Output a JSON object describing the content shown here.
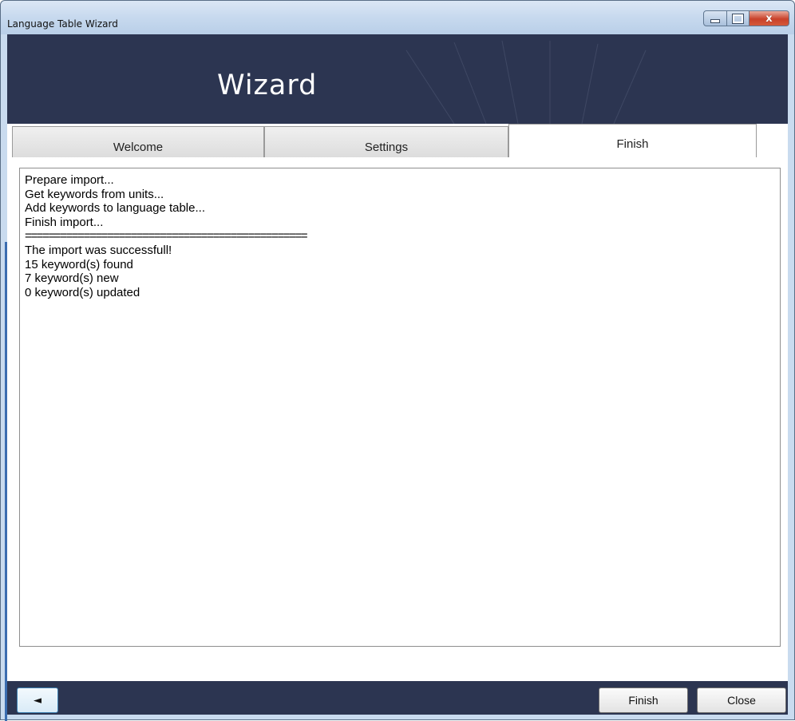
{
  "window": {
    "title": "Language Table Wizard",
    "controls": {
      "minimize_icon": "minimize-icon",
      "maximize_icon": "maximize-icon",
      "close_glyph": "x"
    }
  },
  "banner": {
    "title": "Wizard"
  },
  "tabs": [
    {
      "label": "Welcome",
      "active": false
    },
    {
      "label": "Settings",
      "active": false
    },
    {
      "label": "Finish",
      "active": true
    }
  ],
  "log": {
    "lines": [
      "Prepare import...",
      "Get keywords from units...",
      "Add keywords to language table...",
      "Finish import...",
      "================================================",
      "The import was successfull!",
      "15 keyword(s) found",
      "7 keyword(s) new",
      "0 keyword(s) updated"
    ]
  },
  "footer": {
    "back_glyph": "◄",
    "finish_label": "Finish",
    "close_label": "Close"
  },
  "colors": {
    "banner_bg": "#2c3551",
    "frame": "#c9dbef",
    "close_button": "#c9412a"
  }
}
